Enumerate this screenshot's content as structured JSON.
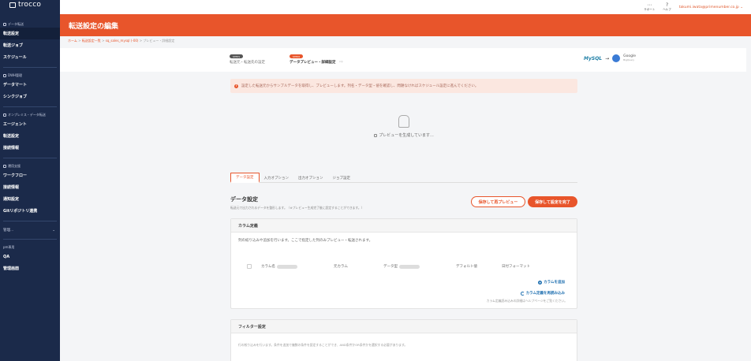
{
  "app": {
    "name": "trocco"
  },
  "sidebar": {
    "sections": [
      {
        "heading": "データ転送",
        "items": [
          {
            "label": "転送設定",
            "active": true
          },
          {
            "label": "転送ジョブ"
          },
          {
            "label": "スケジュール"
          }
        ]
      },
      {
        "heading": "DWH管理",
        "items": [
          {
            "label": "データマート"
          },
          {
            "label": "シンクジョブ"
          }
        ]
      },
      {
        "heading": "オンプレミス・データ転送",
        "items": [
          {
            "label": "エージェント"
          },
          {
            "label": "転送設定"
          },
          {
            "label": "接続情報"
          }
        ]
      },
      {
        "heading": "運用支援",
        "items": [
          {
            "label": "ワークフロー"
          },
          {
            "label": "接続情報"
          },
          {
            "label": "通知設定"
          },
          {
            "label": "Gitリポジトリ連携"
          }
        ]
      }
    ],
    "manage_label": "管理...",
    "pm_heading": "pm専用",
    "pm_items": [
      {
        "label": "QA"
      },
      {
        "label": "管理画面"
      }
    ]
  },
  "topbar": {
    "support": "サポート",
    "help": "ヘルプ",
    "user_email": "takumi.iwata@primenumber.co.jp"
  },
  "header": {
    "title": "転送設定の編集"
  },
  "breadcrumb": {
    "home": "ホーム",
    "list": "転送設定一覧",
    "item": "sq_sales_mysql (-00)",
    "current": "プレビュー・詳細設定",
    "sep": ">"
  },
  "steps": [
    {
      "badge": "STEP1",
      "label": "転送元・転送先の設定"
    },
    {
      "badge": "STEP2",
      "label": "データプレビュー・詳細設定",
      "current": true
    }
  ],
  "connector": {
    "source": "MySQL",
    "dest_top": "Google",
    "dest_bottom": "BigQuery"
  },
  "alert": {
    "text": "設定した転送元からサンプルデータを取得し、プレビューします。列名・データ型・値を確認し、問題なければスケジュール設定に進んでください。"
  },
  "loading": {
    "text": "プレビューを生成しています..."
  },
  "tabs": [
    "データ設定",
    "入力オプション",
    "出力オプション",
    "ジョブ設定"
  ],
  "data_settings": {
    "title": "データ設定",
    "description": "転送元で出力されるデータを整形します。（※プレビュー生成完了後に設定することができます。）",
    "btn_repreview": "保存して再プレビュー",
    "btn_complete": "保存して設定を完了"
  },
  "column_card": {
    "title": "カラム定義",
    "description": "列の絞り込みや追加を行います。ここで指定した列のみプレビュー・転送されます。",
    "headers": [
      "カラム名",
      "元カラム",
      "データ型",
      "デフォルト値",
      "日付フォーマット"
    ],
    "add_label": "カラムを追加",
    "reload_label": "カラム定義を再読み込み",
    "help_text": "カラム定義読み込みの詳細はヘルプページをご覧ください。"
  },
  "filter_card": {
    "title": "フィルター設定",
    "description": "行の絞り込みを行います。条件を追加で複数の条件を設定することができ、AND条件かOR条件かを選択する必要があります。"
  },
  "colors": {
    "brand": "#e8552b",
    "sidebar": "#1b2a4a",
    "link": "#1e6fb0"
  }
}
